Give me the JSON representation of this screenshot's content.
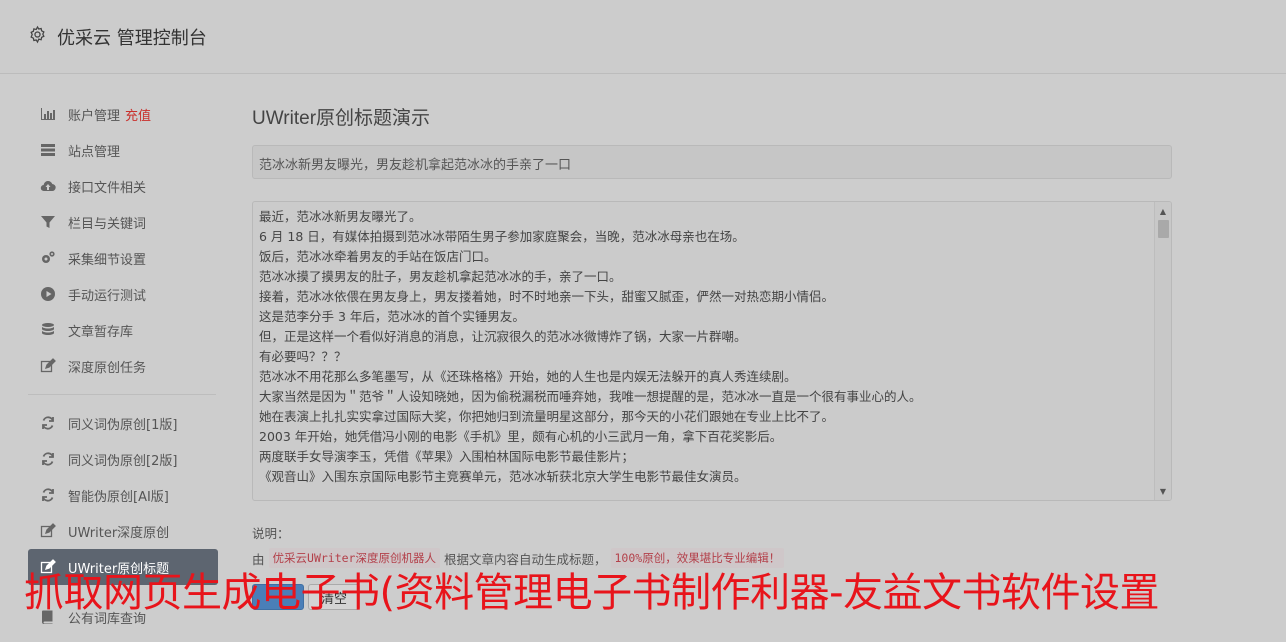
{
  "header": {
    "brand": "优采云 管理控制台"
  },
  "sidebar": {
    "items": [
      {
        "label": "账户管理",
        "extra": "充值",
        "icon": "bar-chart-icon"
      },
      {
        "label": "站点管理",
        "icon": "server-icon"
      },
      {
        "label": "接口文件相关",
        "icon": "cloud-upload-icon"
      },
      {
        "label": "栏目与关键词",
        "icon": "filter-icon"
      },
      {
        "label": "采集细节设置",
        "icon": "gears-icon"
      },
      {
        "label": "手动运行测试",
        "icon": "play-circle-icon"
      },
      {
        "label": "文章暂存库",
        "icon": "database-icon"
      },
      {
        "label": "深度原创任务",
        "icon": "edit-icon"
      },
      {
        "label": "同义词伪原创[1版]",
        "icon": "refresh-icon"
      },
      {
        "label": "同义词伪原创[2版]",
        "icon": "refresh-icon"
      },
      {
        "label": "智能伪原创[AI版]",
        "icon": "refresh-icon"
      },
      {
        "label": "UWriter深度原创",
        "icon": "edit-icon"
      },
      {
        "label": "UWriter原创标题",
        "icon": "edit-icon"
      },
      {
        "label": "公有词库查询",
        "icon": "book-icon"
      }
    ]
  },
  "main": {
    "title": "UWriter原创标题演示",
    "title_value": "范冰冰新男友曝光，男友趁机拿起范冰冰的手亲了一口",
    "content_lines": [
      "最近，范冰冰新男友曝光了。",
      "6 月 18 日，有媒体拍摄到范冰冰带陌生男子参加家庭聚会，当晚，范冰冰母亲也在场。",
      "饭后，范冰冰牵着男友的手站在饭店门口。",
      "范冰冰摸了摸男友的肚子，男友趁机拿起范冰冰的手，亲了一口。",
      "接着，范冰冰依偎在男友身上，男友搂着她，时不时地亲一下头，甜蜜又腻歪，俨然一对热恋期小情侣。",
      "这是范李分手 3 年后，范冰冰的首个实锤男友。",
      "但，正是这样一个看似好消息的消息，让沉寂很久的范冰冰微博炸了锅，大家一片群嘲。",
      "有必要吗？？？",
      "范冰冰不用花那么多笔墨写，从《还珠格格》开始，她的人生也是内娱无法躲开的真人秀连续剧。",
      "大家当然是因为＂范爷＂人设知晓她，因为偷税漏税而唾弃她，我唯一想提醒的是，范冰冰一直是一个很有事业心的人。",
      "她在表演上扎扎实实拿过国际大奖，你把她归到流量明星这部分，那今天的小花们跟她在专业上比不了。",
      "2003 年开始，她凭借冯小刚的电影《手机》里，颇有心机的小三武月一角，拿下百花奖影后。",
      "两度联手女导演李玉，凭借《苹果》入围柏林国际电影节最佳影片；",
      "《观音山》入围东京国际电影节主竞赛单元，范冰冰斩获北京大学生电影节最佳女演员。"
    ],
    "note_label": "说明：",
    "note_prefix": "由",
    "note_code1": "优采云UWriter深度原创机器人",
    "note_middle": "根据文章内容自动生成标题，",
    "note_code2": "100%原创，效果堪比专业编辑！",
    "btn_clear": "清空"
  },
  "watermark": "抓取网页生成电子书(资料管理电子书制作利器-友益文书软件设置"
}
